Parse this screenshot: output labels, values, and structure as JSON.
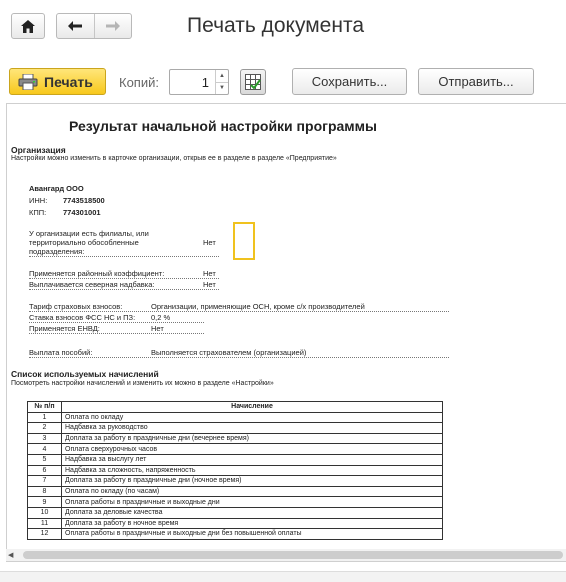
{
  "window": {
    "title": "Печать документа"
  },
  "toolbar": {
    "print_label": "Печать",
    "copies_label": "Копий:",
    "copies_value": "1",
    "save_label": "Сохранить...",
    "send_label": "Отправить..."
  },
  "report": {
    "title": "Результат начальной настройки программы",
    "org_heading": "Организация",
    "org_note": "Настройки можно изменить в карточке организации, открыв ее в разделе в разделе «Предприятие»",
    "org_name": "Авангард ООО",
    "inn_label": "ИНН:",
    "inn_value": "7743518500",
    "kpp_label": "КПП:",
    "kpp_value": "774301001",
    "branches_label_1": "У организации есть филиалы, или",
    "branches_label_2": "территориально обособленные",
    "branches_label_3": "подразделения:",
    "branches_value": "Нет",
    "regional_label": "Применяется районный коэффициент:",
    "regional_value": "Нет",
    "north_label": "Выплачивается северная надбавка:",
    "north_value": "Нет",
    "tariff_label": "Тариф страховых взносов:",
    "tariff_value": "Организации, применяющие ОСН, кроме с/х производителей",
    "fss_label": "Ставка взносов ФСС НС и ПЗ:",
    "fss_value": "0,2 %",
    "envd_label": "Применяется ЕНВД:",
    "envd_value": "Нет",
    "benefits_label": "Выплата пособий:",
    "benefits_value": "Выполняется страхователем (организацией)",
    "accruals_heading": "Список используемых начислений",
    "accruals_note": "Посмотреть настройки начислений и изменить их можно в разделе «Настройки»",
    "table": {
      "col_num": "№ п/п",
      "col_name": "Начисление",
      "rows": [
        {
          "n": "1",
          "name": "Оплата по окладу"
        },
        {
          "n": "2",
          "name": "Надбавка за руководство"
        },
        {
          "n": "3",
          "name": "Доплата за работу в праздничные дни (вечернее время)"
        },
        {
          "n": "4",
          "name": "Оплата сверхурочных часов"
        },
        {
          "n": "5",
          "name": "Надбавка за выслугу лет"
        },
        {
          "n": "6",
          "name": "Надбавка за сложность, напряженность"
        },
        {
          "n": "7",
          "name": "Доплата за работу в праздничные дни (ночное время)"
        },
        {
          "n": "8",
          "name": "Оплата по окладу (по часам)"
        },
        {
          "n": "9",
          "name": "Оплата работы в праздничные и выходные дни"
        },
        {
          "n": "10",
          "name": "Доплата за деловые качества"
        },
        {
          "n": "11",
          "name": "Доплата за работу в ночное время"
        },
        {
          "n": "12",
          "name": "Оплата работы в праздничные и выходные дни без повышенной оплаты"
        }
      ]
    }
  },
  "icons": {
    "home": "home-icon",
    "back": "arrow-left-icon",
    "forward": "arrow-right-icon",
    "printer": "printer-icon",
    "table_settings": "table-grid-icon"
  },
  "colors": {
    "print_button": "#f7c81c",
    "highlight_box": "#f0c21e"
  }
}
